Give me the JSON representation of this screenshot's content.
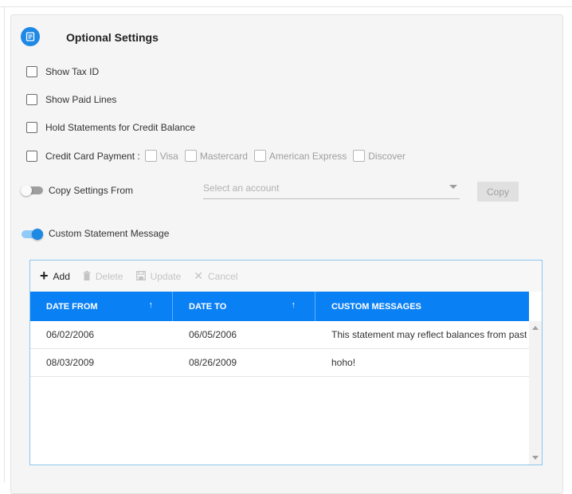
{
  "section": {
    "title": "Optional Settings",
    "icon": "document-icon",
    "accent_color": "#1e88e5"
  },
  "options": {
    "show_tax_id": {
      "label": "Show Tax ID",
      "checked": false
    },
    "show_paid_lines": {
      "label": "Show Paid Lines",
      "checked": false
    },
    "hold_statements": {
      "label": "Hold Statements for Credit Balance",
      "checked": false
    },
    "credit_card": {
      "label": "Credit Card Payment :",
      "checked": false,
      "types": [
        {
          "label": "Visa",
          "checked": false
        },
        {
          "label": "Mastercard",
          "checked": false
        },
        {
          "label": "American Express",
          "checked": false
        },
        {
          "label": "Discover",
          "checked": false
        }
      ]
    }
  },
  "copy_settings": {
    "label": "Copy Settings From",
    "enabled": false,
    "select_placeholder": "Select an account",
    "button_label": "Copy"
  },
  "custom_message": {
    "label": "Custom Statement Message",
    "enabled": true
  },
  "grid": {
    "toolbar": {
      "add": "Add",
      "delete": "Delete",
      "update": "Update",
      "cancel": "Cancel"
    },
    "header_color": "#0a80f5",
    "columns": [
      "DATE FROM",
      "DATE TO",
      "CUSTOM MESSAGES"
    ],
    "sort_indicator": "↑",
    "rows": [
      {
        "date_from": "06/02/2006",
        "date_to": "06/05/2006",
        "message": "This statement may reflect balances from past"
      },
      {
        "date_from": "08/03/2009",
        "date_to": "08/26/2009",
        "message": "hoho!"
      }
    ]
  }
}
